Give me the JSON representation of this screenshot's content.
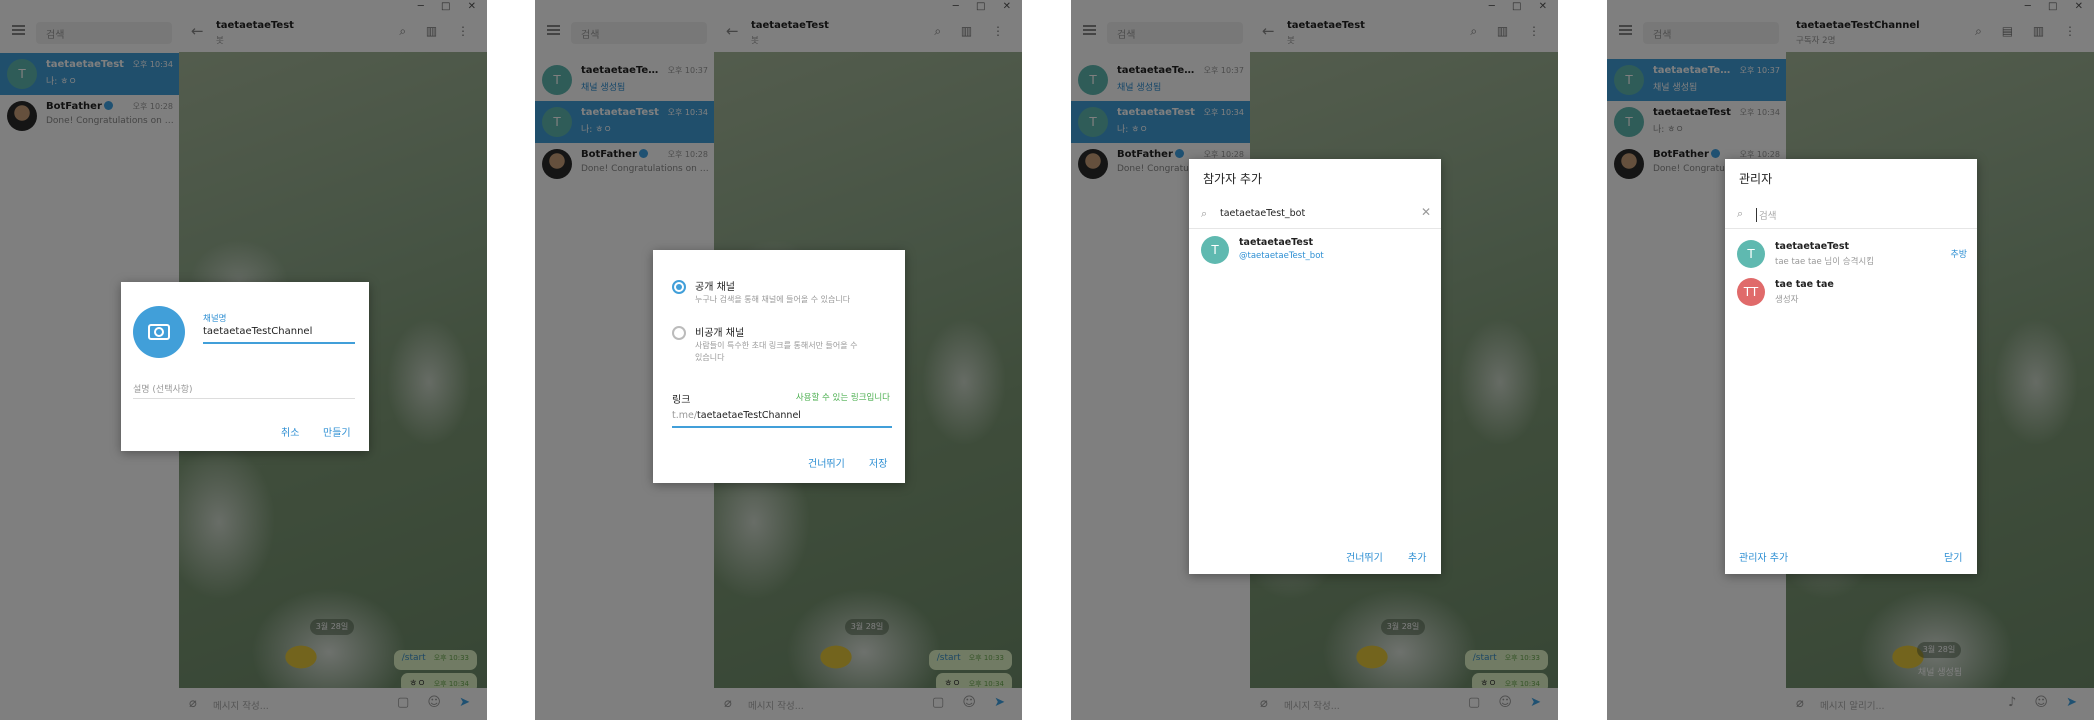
{
  "sidebar": {
    "search_placeholder": "검색",
    "chats": [
      {
        "name": "taetaetaeTest",
        "time": "오후 10:34",
        "preview": "나: ㅎㅇ",
        "avatar": "T"
      },
      {
        "name": "taetaetaeTestChannel",
        "time": "오후 10:37",
        "preview": "채널 생성됨",
        "avatar": "T"
      },
      {
        "name": "BotFather",
        "time": "오후 10:28",
        "preview": "Done! Congratulations on yo..."
      }
    ]
  },
  "chat": {
    "title": "taetaetaeTest",
    "subtitle": "봇",
    "date_chip": "3월 28일",
    "messages": [
      {
        "text": "/start",
        "time": "오후 10:33"
      },
      {
        "text": "ㅎㅇ",
        "time": "오후 10:34"
      }
    ],
    "composer_placeholder": "메시지 작성...",
    "channel_title": "taetaetaeTestChannel",
    "channel_subtitle": "구독자 2명",
    "channel_system_msg": "채널 생성됨",
    "channel_composer_placeholder": "메시지 알리기..."
  },
  "dialog1": {
    "name_label": "채널명",
    "name_value": "taetaetaeTestChannel",
    "desc_placeholder": "설명 (선택사항)",
    "cancel": "취소",
    "create": "만들기"
  },
  "dialog2": {
    "public_title": "공개 채널",
    "public_desc": "누구나 검색을 통해 채널에 들어올 수 있습니다",
    "private_title": "비공개 채널",
    "private_desc_1": "사람들이 특수한 초대 링크를 통해서만 들어올 수",
    "private_desc_2": "있습니다",
    "link_label": "링크",
    "link_status": "사용할 수 있는 링크입니다",
    "link_prefix": "t.me/",
    "link_value": "taetaetaeTestChannel",
    "skip": "건너뛰기",
    "save": "저장"
  },
  "dialog3": {
    "title": "참가자 추가",
    "search_value": "taetaetaeTest_bot",
    "result_name": "taetaetaeTest",
    "result_handle": "@taetaetaeTest_bot",
    "result_avatar": "T",
    "skip": "건너뛰기",
    "add": "추가"
  },
  "dialog4": {
    "title": "관리자",
    "search_placeholder": "검색",
    "admins": [
      {
        "name": "taetaetaeTest",
        "role": "tae tae tae 님이 승격시킴",
        "avatar": "T",
        "action": "추방"
      },
      {
        "name": "tae tae tae",
        "role": "생성자",
        "avatar": "TT"
      }
    ],
    "add_admin": "관리자 추가",
    "close": "닫기"
  },
  "colors": {
    "accent": "#419fd9",
    "link": "#2e8fd3",
    "available": "#4caf50",
    "bubble": "#e3f7c9"
  }
}
